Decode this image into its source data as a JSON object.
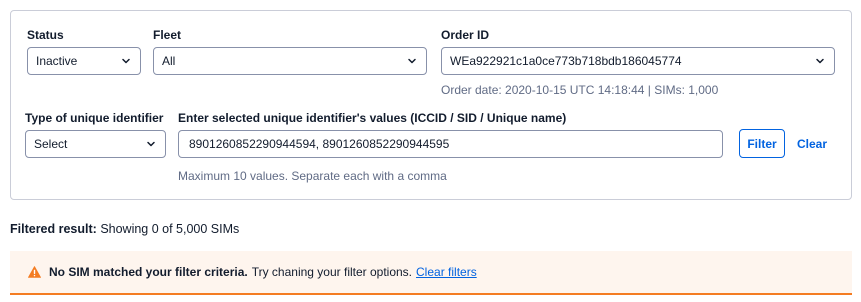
{
  "filters": {
    "status": {
      "label": "Status",
      "value": "Inactive"
    },
    "fleet": {
      "label": "Fleet",
      "value": "All"
    },
    "order": {
      "label": "Order ID",
      "value": "WEa922921c1a0ce773b718bdb186045774",
      "meta": "Order date: 2020-10-15 UTC 14:18:44 | SIMs: 1,000"
    },
    "identifier_type": {
      "label": "Type of unique identifier",
      "value": "Select"
    },
    "identifier_values": {
      "label": "Enter selected unique identifier's values (ICCID / SID / Unique name)",
      "value": "8901260852290944594, 8901260852290944595",
      "help": "Maximum 10 values. Separate each with a comma"
    },
    "filter_button": "Filter",
    "clear_button": "Clear"
  },
  "result": {
    "label": "Filtered result:",
    "text": "Showing 0 of 5,000 SIMs"
  },
  "alert": {
    "title": "No SIM matched your filter criteria.",
    "message": "Try chaning your filter options.",
    "link": "Clear filters",
    "icon": "warning-icon",
    "accent_color": "#f47c22",
    "background_color": "#fef5ee"
  },
  "colors": {
    "link": "#0263e0",
    "border": "#8891aa"
  }
}
